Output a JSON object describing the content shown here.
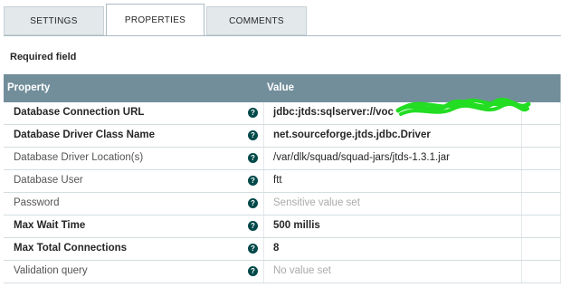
{
  "tabs": {
    "settings": "SETTINGS",
    "properties": "PROPERTIES",
    "comments": "COMMENTS"
  },
  "required_note": "Required field",
  "table": {
    "headers": {
      "property": "Property",
      "value": "Value"
    },
    "rows": [
      {
        "name": "Database Connection URL",
        "value": "jdbc:jtds:sqlserver://voc",
        "required": true,
        "value_style": "bold"
      },
      {
        "name": "Database Driver Class Name",
        "value": "net.sourceforge.jtds.jdbc.Driver",
        "required": true,
        "value_style": "bold"
      },
      {
        "name": "Database Driver Location(s)",
        "value": "/var/dlk/squad/squad-jars/jtds-1.3.1.jar",
        "required": false,
        "value_style": "normal"
      },
      {
        "name": "Database User",
        "value": "ftt",
        "required": false,
        "value_style": "normal"
      },
      {
        "name": "Password",
        "value": "Sensitive value set",
        "required": false,
        "value_style": "muted"
      },
      {
        "name": "Max Wait Time",
        "value": "500 millis",
        "required": true,
        "value_style": "bold"
      },
      {
        "name": "Max Total Connections",
        "value": "8",
        "required": true,
        "value_style": "bold"
      },
      {
        "name": "Validation query",
        "value": "No value set",
        "required": false,
        "value_style": "muted"
      }
    ]
  },
  "help_icon": "question-circle-icon",
  "colors": {
    "header_bg": "#728e9b",
    "help_icon": "#004849",
    "tab_bg": "#e3e8eb",
    "redaction": "#22dd22"
  }
}
